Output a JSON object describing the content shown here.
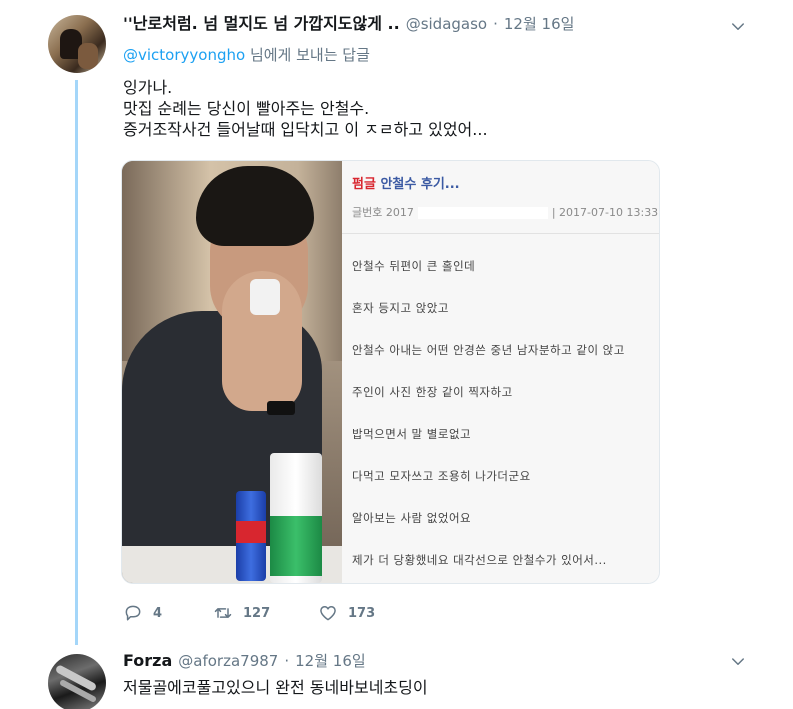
{
  "tweet1": {
    "name": "''난로처럼. 넘 멀지도 넘 가깝지도않게 ..",
    "handle": "@sidagaso",
    "separator": "·",
    "date": "12월 16일",
    "reply_mention": "@victoryyongho",
    "reply_suffix": " 님에게 보내는 답글",
    "lines": [
      "잉가나.",
      "맛집 순례는 당신이 빨아주는 안철수.",
      "증거조작사건 들어날때 입닥치고 이 ㅈㄹ하고 있었어..."
    ],
    "image_post": {
      "title_tag": "펌글",
      "title": "안철수 후기...",
      "meta_prefix": "글번호 2017",
      "meta_suffix": "| 2017-07-10 13:33",
      "lines": [
        "안철수 뒤편이 큰 홀인데",
        "혼자 등지고 앉았고",
        "안철수 아내는 어떤 안경쓴 중년 남자분하고 같이 앉고",
        "주인이 사진 한장 같이 찍자하고",
        "밥먹으면서 말 별로없고",
        "다먹고 모자쓰고 조용히 나가더군요",
        "알아보는 사람 없었어요",
        "제가 더 당황했네요 대각선으로 안철수가 있어서..."
      ]
    },
    "actions": {
      "reply_count": "4",
      "retweet_count": "127",
      "like_count": "173"
    }
  },
  "tweet2": {
    "name": "Forza",
    "handle": "@aforza7987",
    "separator": "·",
    "date": "12월 16일",
    "text": "저물골에코풀고있으니  완전 동네바보네초딩이"
  },
  "colors": {
    "link": "#1da1f2",
    "thread_line": "#a4d6f9",
    "secondary_text": "#657786"
  }
}
